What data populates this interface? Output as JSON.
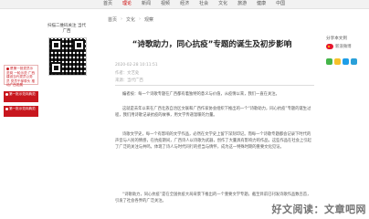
{
  "nav": {
    "items": [
      "首页",
      "理论",
      "新闻",
      "视频",
      "经济",
      "社会",
      "文化",
      "旅游",
      "健康",
      "中国"
    ],
    "active_index": 1
  },
  "breadcrumb": {
    "home": "首页",
    "section1": "文化",
    "section2": "观察"
  },
  "left": {
    "follow_text": "扫描二维码关注 当代广西",
    "banners": [
      "是第一批党员示范岗 一轮示范 广西建设当代党员公务员 党员干部带头 推动广西发展",
      "第一批示范岗典范",
      "第一批示范岗典范"
    ]
  },
  "article": {
    "title": "“诗歌助力，同心抗疫”专题的诞生及初步影响",
    "date": "2020-02-28 10:11:51",
    "author": "作者：文艺处",
    "source": "来源：当代广西",
    "paragraphs": [
      "编者按：每一个诗歌专题在广西都有着独特的意义与价值，从疫情以来，我们一直在关注。",
      "这就是去年以来在广西壮族自治区文联和广西作家协会组织下推出的一个“诗歌助力，同心抗疫”专题的诞生过程，我们用诗歌记录抗疫的故事，用文学传递温暖的力量。",
      "诗歌文学史，每一个有影响的文学作品，必然在文学史上留下深刻印记。而每一个诗歌专题都会记录下时代的声音与人民的情感，在抗疫期间，广西诗人以诗歌为武器，创作了大量具有影响力的作品，这些作品在社会上引起了广泛的关注与共鸣，体现了诗人与时代同行的担当与情怀，成为这一特殊时期的重要文化见证。",
      "“诗歌助力，同心抗疫”是在全国抗疫大局背景下推出的一个重要文学专题，截至目前已刊发诗歌作品数百首，引发了社会各界的广泛关注。"
    ]
  },
  "share": {
    "label": "分享本文到",
    "weibo_label": "新浪微博"
  },
  "watermark": "好文阅读：文章吧网"
}
